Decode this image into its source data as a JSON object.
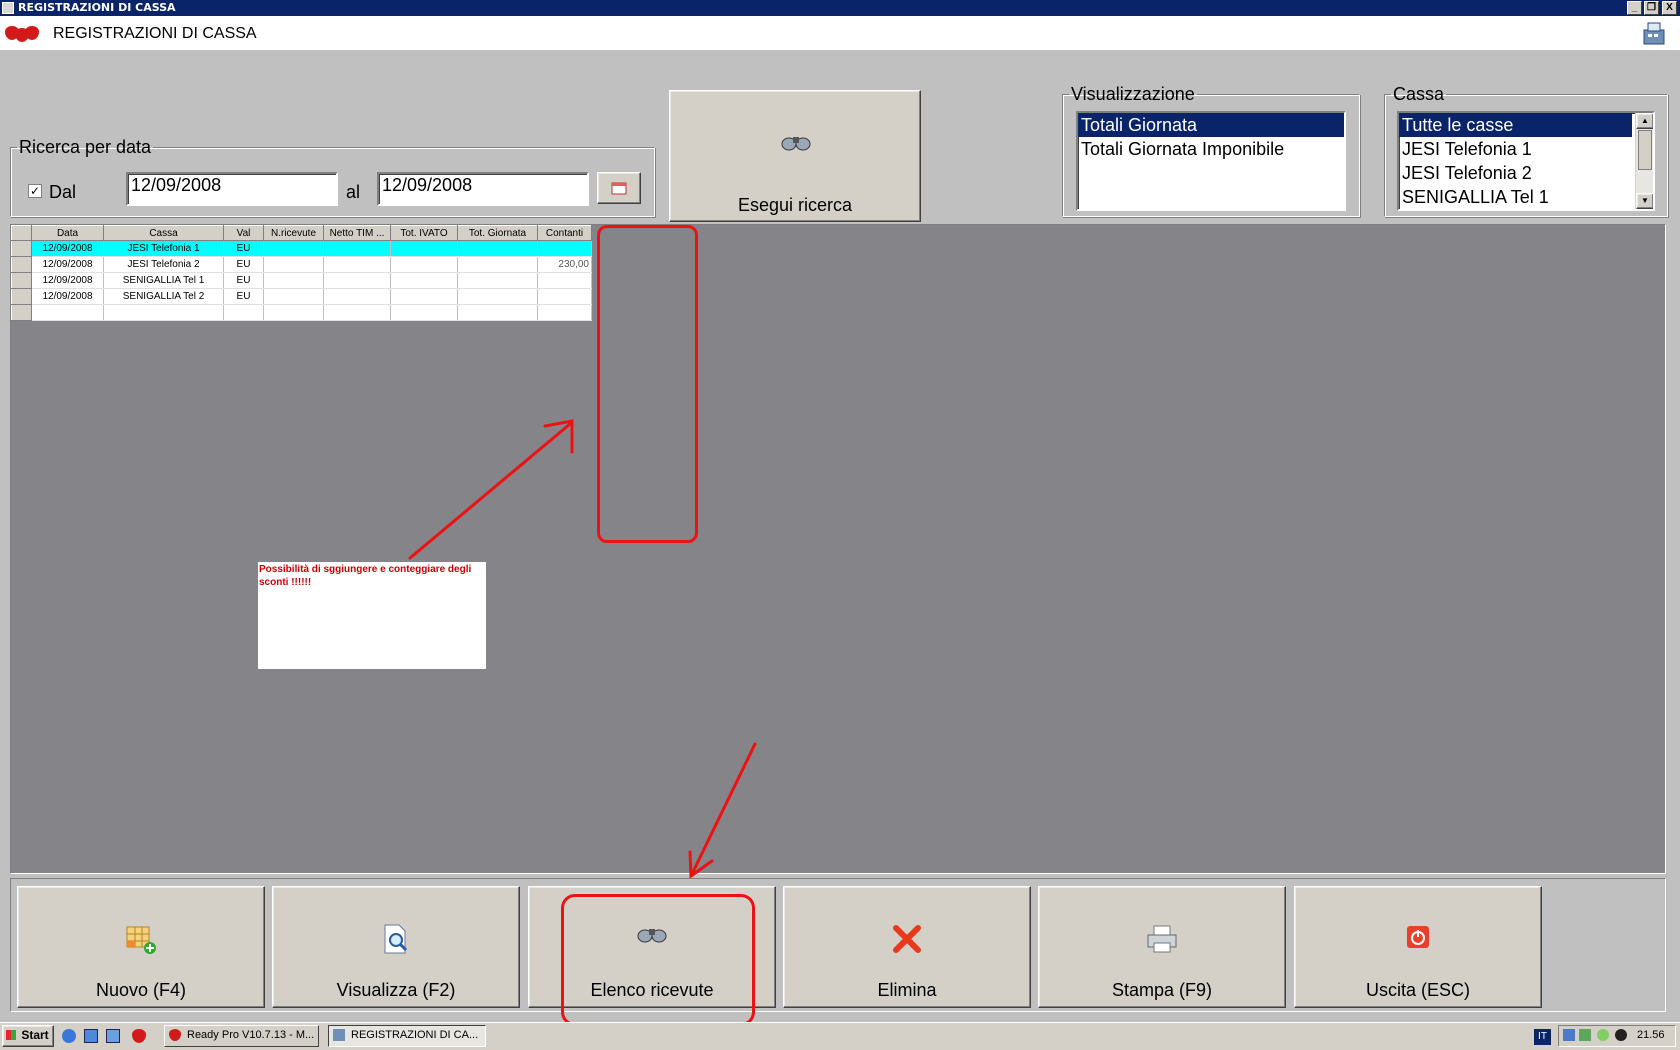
{
  "window": {
    "title": "REGISTRAZIONI DI CASSA",
    "minimize": "_",
    "restore": "❐",
    "close": "X"
  },
  "header": {
    "title": "REGISTRAZIONI DI CASSA"
  },
  "search_by_date": {
    "legend": "Ricerca per data",
    "from_checked": true,
    "from_label": "Dal",
    "from_value": "12/09/2008",
    "to_label": "al",
    "to_value": "12/09/2008"
  },
  "search_button": {
    "label": "Esegui ricerca"
  },
  "view": {
    "legend": "Visualizzazione",
    "items": [
      "Totali Giornata",
      "Totali Giornata Imponibile"
    ],
    "selected": "Totali Giornata"
  },
  "register": {
    "legend": "Cassa",
    "items": [
      "Tutte le casse",
      "JESI Telefonia 1",
      "JESI Telefonia 2",
      "SENIGALLIA Tel 1"
    ],
    "selected": "Tutte le casse"
  },
  "grid": {
    "columns": [
      "Data",
      "Cassa",
      "Val",
      "N.ricevute",
      "Netto TIM ...",
      "Tot. IVATO",
      "Tot. Giornata",
      "Contanti"
    ],
    "rows": [
      [
        "12/09/2008",
        "JESI Telefonia 1",
        "EU",
        "",
        "",
        "",
        "",
        ""
      ],
      [
        "12/09/2008",
        "JESI Telefonia 2",
        "EU",
        "",
        "",
        "",
        "",
        "230,00"
      ],
      [
        "12/09/2008",
        "SENIGALLIA Tel 1",
        "EU",
        "",
        "",
        "",
        "",
        ""
      ],
      [
        "12/09/2008",
        "SENIGALLIA Tel 2",
        "EU",
        "",
        "",
        "",
        "",
        ""
      ],
      [
        "",
        "",
        "",
        "",
        "",
        "",
        "",
        ""
      ]
    ]
  },
  "note": {
    "text": "Possibilità di sggiungere e conteggiare degli sconti !!!!!!"
  },
  "buttons": {
    "new": "Nuovo (F4)",
    "view": "Visualizza (F2)",
    "receipts": "Elenco ricevute",
    "delete": "Elimina",
    "print": "Stampa (F9)",
    "exit": "Uscita (ESC)"
  },
  "taskbar": {
    "start": "Start",
    "tasks": [
      "Ready Pro V10.7.13 - M...",
      "REGISTRAZIONI DI CA..."
    ],
    "lang": "IT",
    "clock": "21.56"
  },
  "colors": {
    "titlebar": "#0a246a",
    "selection": "#0a246a",
    "row_highlight": "#00ffff",
    "grid_bg": "#858489",
    "annotation": "#ee1111"
  }
}
